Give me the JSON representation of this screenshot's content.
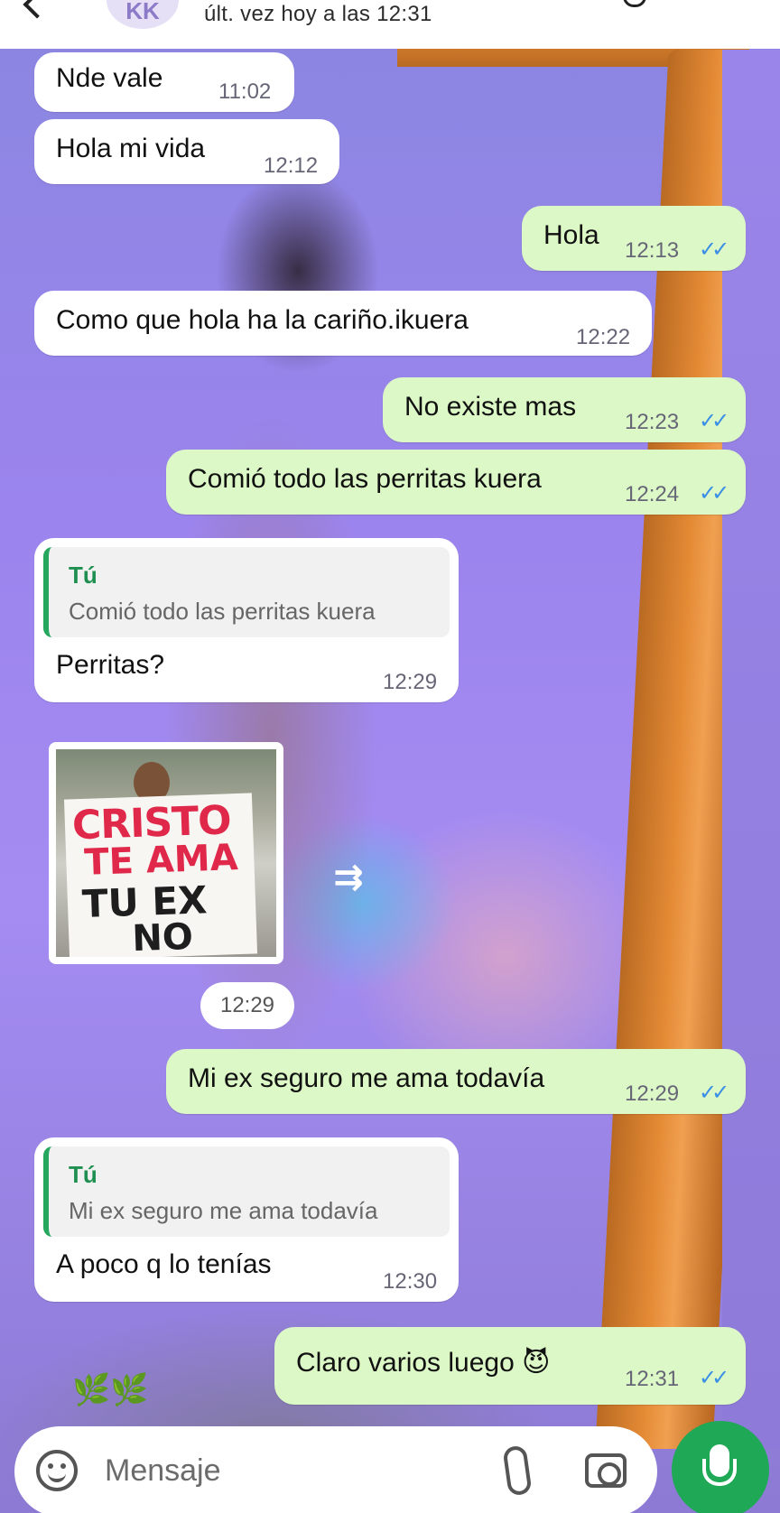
{
  "header": {
    "contact_initials": "KK",
    "status": "últ. vez hoy a las 12:31",
    "icons": [
      "back-arrow-icon",
      "call-icon",
      "menu-icon"
    ]
  },
  "messages": [
    {
      "dir": "in",
      "text": "Nde vale",
      "time": "11:02"
    },
    {
      "dir": "in",
      "text": "Hola mi vida",
      "time": "12:12"
    },
    {
      "dir": "out",
      "text": "Hola",
      "time": "12:13",
      "read": true
    },
    {
      "dir": "in",
      "text": "Como que hola ha la cariño.ikuera",
      "time": "12:22"
    },
    {
      "dir": "out",
      "text": "No existe mas",
      "time": "12:23",
      "read": true
    },
    {
      "dir": "out",
      "text": "Comió todo las perritas kuera",
      "time": "12:24",
      "read": true
    },
    {
      "dir": "in",
      "quote_author": "Tú",
      "quote_text": "Comió todo las perritas kuera",
      "text": "Perritas?",
      "time": "12:29"
    },
    {
      "dir": "in",
      "type": "sticker",
      "sticker_text": [
        "CRISTO",
        "TE AMA",
        "TU EX",
        "NO"
      ],
      "time": "12:29"
    },
    {
      "dir": "out",
      "text": "Mi ex seguro me ama todavía",
      "time": "12:29",
      "read": true
    },
    {
      "dir": "in",
      "quote_author": "Tú",
      "quote_text": "Mi ex seguro me ama todavía",
      "text": "A poco q lo tenías",
      "time": "12:30"
    },
    {
      "dir": "out",
      "text": "Claro varios luego 😈",
      "time": "12:31",
      "read": true
    }
  ],
  "read_ticks": "✓✓",
  "forward_glyph": "⇉",
  "leaves_glyph": "🌿🌿",
  "composer": {
    "placeholder": "Mensaje",
    "icons": [
      "emoji-icon",
      "attach-icon",
      "camera-icon",
      "mic-icon"
    ]
  },
  "colors": {
    "outgoing_bubble": "#dcf8c6",
    "incoming_bubble": "#ffffff",
    "read_tick": "#3a8ee6",
    "mic_button": "#1fa855",
    "quote_bar": "#25a85e"
  }
}
